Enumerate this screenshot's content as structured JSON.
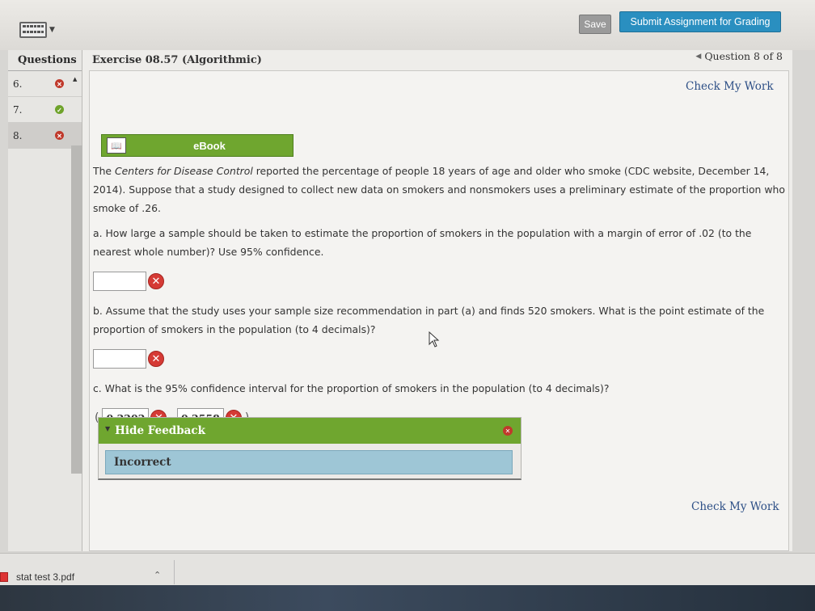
{
  "toolbar": {
    "keyboard_icon": "keyboard-icon",
    "save_label": "Save",
    "submit_label": "Submit Assignment for Grading"
  },
  "questions_panel": {
    "header": "Questions",
    "items": [
      {
        "number": "6.",
        "status": "incorrect"
      },
      {
        "number": "7.",
        "status": "correct"
      },
      {
        "number": "8.",
        "status": "incorrect"
      }
    ]
  },
  "exercise": {
    "title": "Exercise 08.57 (Algorithmic)",
    "question_nav": "Question 8 of 8",
    "check_my_work": "Check My Work",
    "ebook_label": "eBook"
  },
  "problem": {
    "intro_pre": "The ",
    "intro_source": "Centers for Disease Control",
    "intro_post": " reported the percentage of people 18 years of age and older who smoke (CDC website, December 14, 2014). Suppose that a study designed to collect new data on smokers and nonsmokers uses a preliminary estimate of the proportion who smoke of .26.",
    "part_a": "a. How large a sample should be taken to estimate the proportion of smokers in the population with a margin of error of .02 (to the nearest whole number)? Use 95% confidence.",
    "answer_a": "",
    "part_b": "b. Assume that the study uses your sample size recommendation in part (a) and finds 520 smokers. What is the point estimate of the proportion of smokers in the population (to 4 decimals)?",
    "answer_b": "",
    "part_c": "c. What is the 95% confidence interval for the proportion of smokers in the population (to 4 decimals)?",
    "answer_c_lower": "0.2202",
    "answer_c_upper": "0.2558",
    "open_paren": "(",
    "comma": ",",
    "close_paren": ")"
  },
  "feedback": {
    "toggle_label": "Hide Feedback",
    "result": "Incorrect"
  },
  "downloads": {
    "file_name": "stat test 3.pdf"
  },
  "colors": {
    "accent_green": "#6fa62f",
    "submit_blue": "#2a8fc0",
    "error_red": "#d53a35",
    "link_blue": "#2d4f86"
  }
}
